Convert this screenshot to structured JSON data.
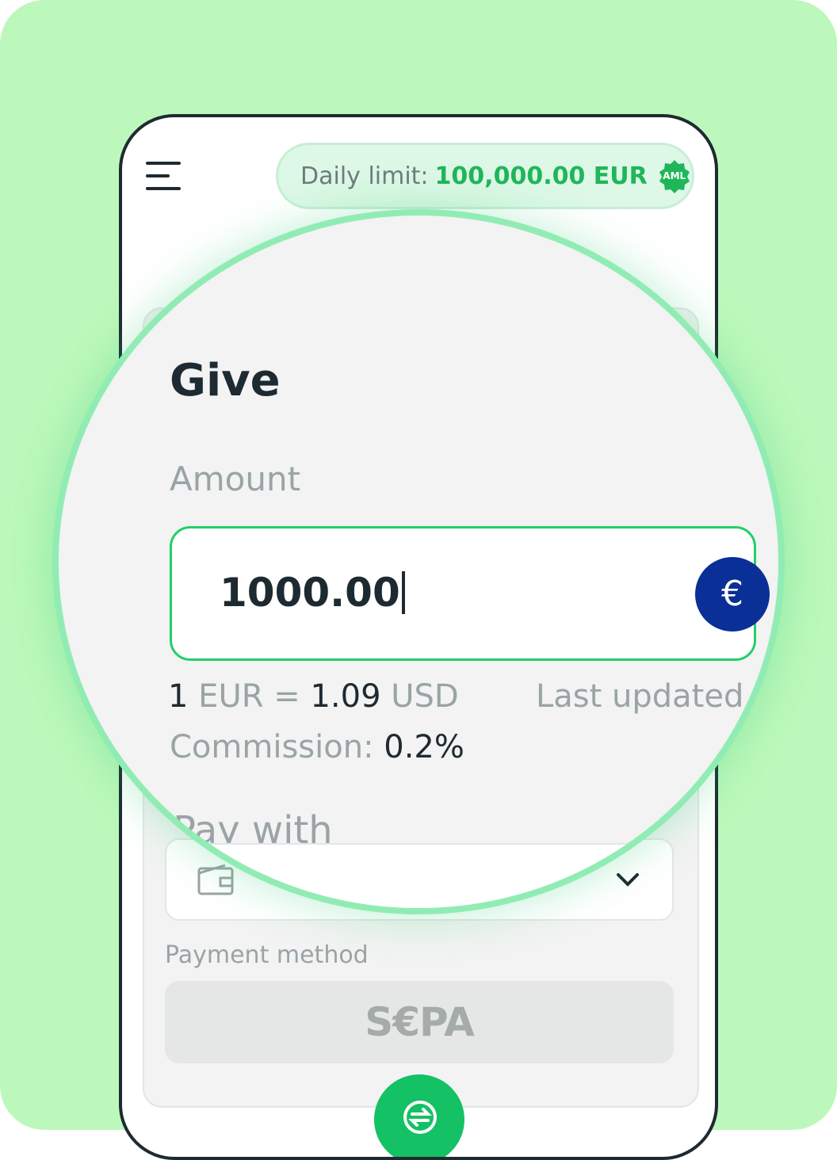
{
  "header": {
    "daily_limit_label": "Daily limit:",
    "daily_limit_value": "100,000.00 EUR",
    "aml_badge": "AML"
  },
  "give": {
    "title": "Give",
    "amount_label": "Amount",
    "amount_value": "1000.00",
    "currency_symbol": "€",
    "rate_prefix": "1",
    "rate_from": "EUR =",
    "rate_value": "1.09",
    "rate_to": "USD",
    "last_updated": "Last updated",
    "commission_label": "Commission:",
    "commission_value": "0.2%",
    "pay_with_label": "Pay with",
    "payment_method_label": "Payment method",
    "payment_method_logo": "S€PA"
  },
  "colors": {
    "background": "#bcf8bb",
    "accent_green": "#22cf69",
    "euro_blue": "#0a2f96",
    "text_dark": "#1e2a31",
    "text_muted": "#9aa3a6"
  }
}
